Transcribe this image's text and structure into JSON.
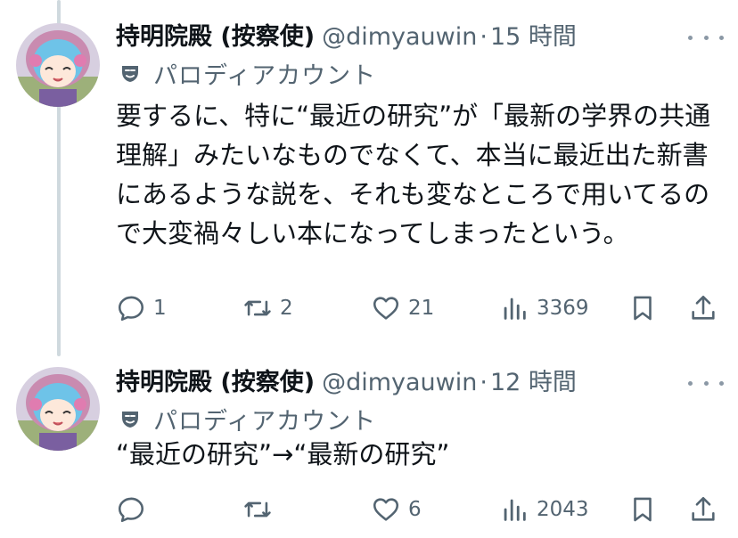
{
  "tweets": [
    {
      "display_name": "持明院殿 (按察使)",
      "handle": "@dimyauwin",
      "separator": "·",
      "time": "15 時間",
      "label": "パロディアカウント",
      "text": "要するに、特に“最近の研究”が「最新の学界の共通理解」みたいなものでなくて、本当に最近出た新書にあるような説を、それも変なところで用いてるので大変禍々しい本になってしまったという。",
      "replies": "1",
      "retweets": "2",
      "likes": "21",
      "views": "3369"
    },
    {
      "display_name": "持明院殿 (按察使)",
      "handle": "@dimyauwin",
      "separator": "·",
      "time": "12 時間",
      "label": "パロディアカウント",
      "text": "“最近の研究”→“最新の研究”",
      "replies": "",
      "retweets": "",
      "likes": "6",
      "views": "2043"
    }
  ],
  "icons": {
    "reply": "reply-icon",
    "retweet": "retweet-icon",
    "like": "heart-icon",
    "views": "views-icon",
    "bookmark": "bookmark-icon",
    "share": "share-icon",
    "more": "more-icon",
    "parody": "parody-mask-icon"
  },
  "colors": {
    "text": "#0f1419",
    "secondary": "#536471",
    "thread_line": "#cfd9de"
  }
}
